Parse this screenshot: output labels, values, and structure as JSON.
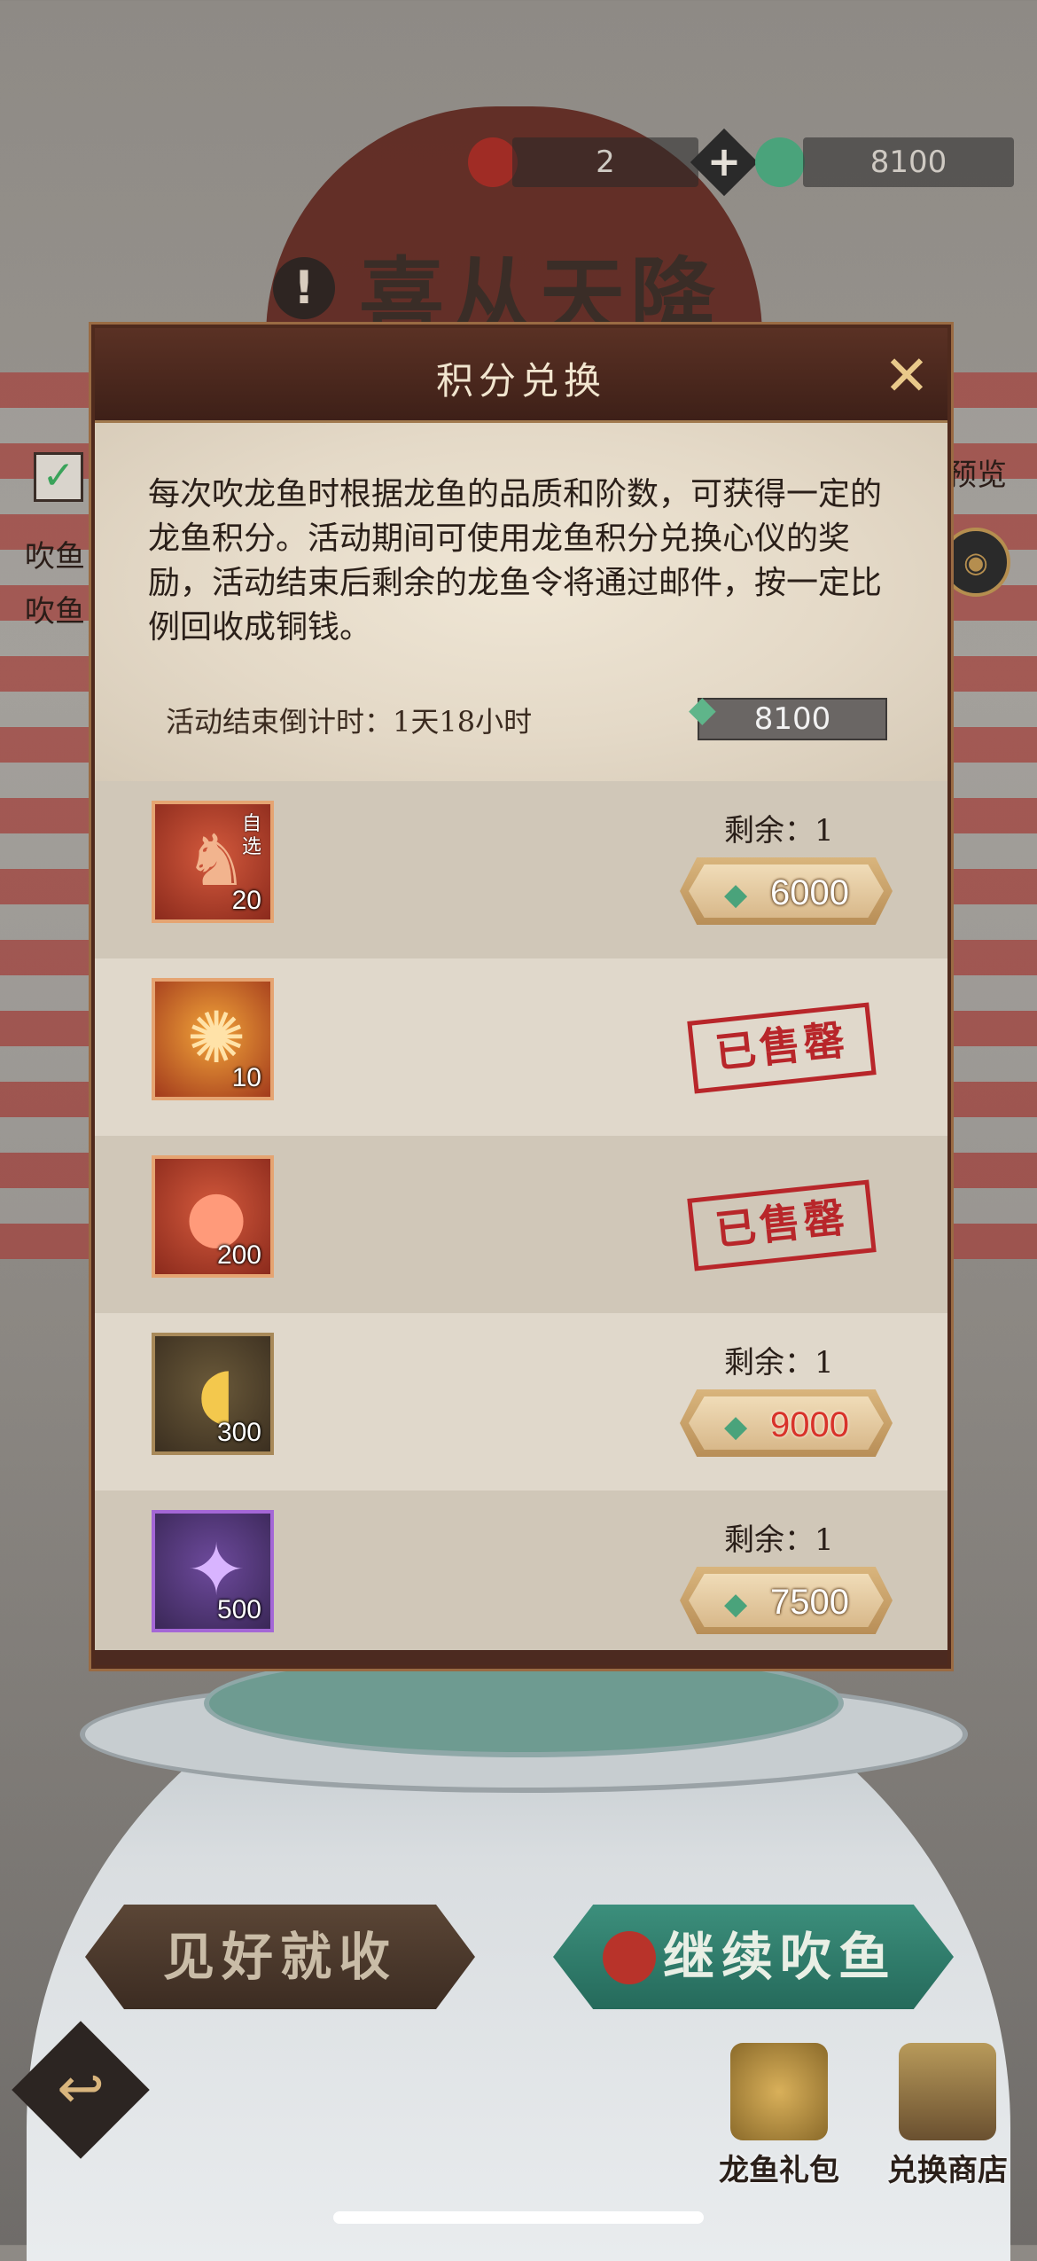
{
  "background": {
    "title": "喜从天降",
    "left_labels": [
      "吹鱼",
      "吹鱼"
    ],
    "right_label": "预览",
    "warning": "!"
  },
  "top_bar": {
    "fish_ball_count": "2",
    "points": "8100",
    "plus": "+"
  },
  "modal": {
    "title": "积分兑换",
    "close": "✕",
    "description": "每次吹龙鱼时根据龙鱼的品质和阶数，可获得一定的龙鱼积分。活动期间可使用龙鱼积分兑换心仪的奖励，活动结束后剩余的龙鱼令将通过邮件，按一定比例回收成铜钱。",
    "countdown": "活动结束倒计时：1天18小时",
    "points": "8100",
    "items": [
      {
        "count": "20",
        "tag": "自选",
        "status": "available",
        "remaining": "剩余：1",
        "price": "6000",
        "price_color": "normal"
      },
      {
        "count": "10",
        "status": "sold_out",
        "stamp": "已售罄"
      },
      {
        "count": "200",
        "status": "sold_out",
        "stamp": "已售罄"
      },
      {
        "count": "300",
        "status": "available",
        "remaining": "剩余：1",
        "price": "9000",
        "price_color": "red"
      },
      {
        "count": "500",
        "status": "available",
        "remaining": "剩余：1",
        "price": "7500",
        "price_color": "normal"
      }
    ]
  },
  "bottom": {
    "left_button": "见好就收",
    "right_button": "继续吹鱼",
    "back_icon": "↩",
    "shortcuts": [
      {
        "label": "龙鱼礼包",
        "icon": "gift-bag-icon"
      },
      {
        "label": "兑换商店",
        "icon": "shop-icon"
      }
    ]
  },
  "colors": {
    "accent_gold": "#d9b57d",
    "accent_green": "#2f7d6b",
    "stamp_red": "#b8262a"
  }
}
